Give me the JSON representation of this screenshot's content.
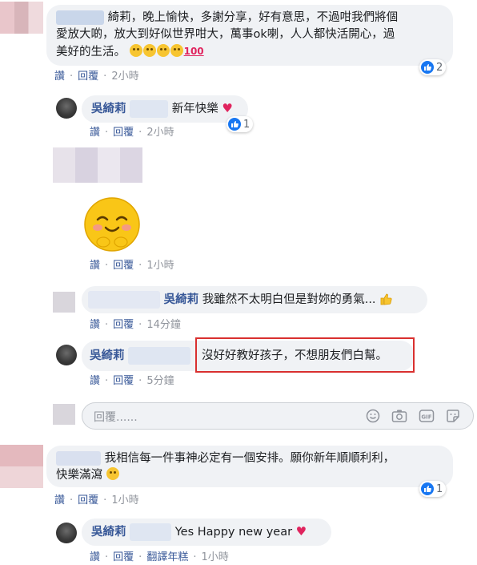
{
  "comments": [
    {
      "text_line1": "綺莉，晚上愉快，多謝分享，好有意思，不過咁我們將個",
      "text_line2": "愛放大啲，放大到好似世界咁大，萬事ok喇，人人都快活開心，過",
      "text_line3": "美好的生活。",
      "like": "讚",
      "reply": "回覆",
      "time": "2小時",
      "reactions": "2"
    },
    {
      "name": "吳綺莉",
      "text": "新年快樂",
      "like": "讚",
      "reply": "回覆",
      "time": "2小時",
      "reactions": "1"
    },
    {
      "like": "讚",
      "reply": "回覆",
      "time": "1小時"
    },
    {
      "name": "吳綺莉",
      "text": "我雖然不太明白但是對妳的勇氣...",
      "like": "讚",
      "reply": "回覆",
      "time": "14分鐘"
    },
    {
      "name": "吳綺莉",
      "text": "沒好好教好孩子，不想朋友們白幫。",
      "like": "讚",
      "reply": "回覆",
      "time": "5分鐘"
    },
    {
      "text_line1": "我相信每一件事神必定有一個安排。願你新年順順利利，",
      "text_line2": "快樂滿瀉",
      "like": "讚",
      "reply": "回覆",
      "time": "1小時",
      "reactions": "1"
    },
    {
      "name": "吳綺莉",
      "text": "Yes Happy new year",
      "like": "讚",
      "reply": "回覆",
      "translate": "翻譯年糕",
      "time": "1小時"
    }
  ],
  "reply_input": {
    "placeholder": "回覆......"
  },
  "colors": {
    "link": "#385898",
    "bubble": "#f0f2f5",
    "highlight": "#d9302f",
    "like": "#1877f2"
  },
  "icons": [
    "like-icon",
    "smile-icon",
    "camera-icon",
    "gif-icon",
    "sticker-icon",
    "heart-icon",
    "thumbs-up-icon"
  ]
}
